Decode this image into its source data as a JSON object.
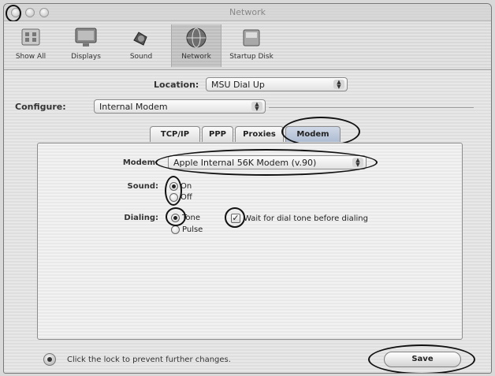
{
  "window": {
    "title": "Network"
  },
  "toolbar": {
    "items": [
      {
        "label": "Show All",
        "icon": "show-all-icon"
      },
      {
        "label": "Displays",
        "icon": "display-icon"
      },
      {
        "label": "Sound",
        "icon": "speaker-icon"
      },
      {
        "label": "Network",
        "icon": "network-globe-icon",
        "selected": true
      },
      {
        "label": "Startup Disk",
        "icon": "disk-icon"
      }
    ]
  },
  "location": {
    "label": "Location:",
    "value": "MSU Dial Up"
  },
  "configure": {
    "label": "Configure:",
    "value": "Internal Modem"
  },
  "tabs": [
    {
      "label": "TCP/IP"
    },
    {
      "label": "PPP"
    },
    {
      "label": "Proxies"
    },
    {
      "label": "Modem",
      "active": true
    }
  ],
  "modem": {
    "label": "Modem:",
    "value": "Apple Internal 56K Modem (v.90)"
  },
  "sound": {
    "label": "Sound:",
    "options": [
      {
        "label": "On",
        "checked": true
      },
      {
        "label": "Off",
        "checked": false
      }
    ]
  },
  "dialing": {
    "label": "Dialing:",
    "options": [
      {
        "label": "Tone",
        "checked": true
      },
      {
        "label": "Pulse",
        "checked": false
      }
    ],
    "wait_checkbox": {
      "label": "Wait for dial tone before dialing",
      "checked": true,
      "mark": "✓"
    }
  },
  "footer": {
    "lock_text": "Click the lock to prevent further changes.",
    "save_label": "Save"
  },
  "colors": {
    "active_tab": "#aebcd2",
    "annotation": "#111111"
  }
}
